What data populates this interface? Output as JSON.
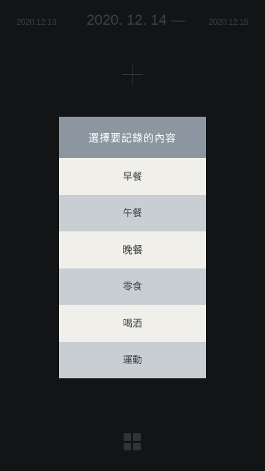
{
  "date_nav": {
    "prev": "2020.12.13",
    "current": "2020. 12. 14 —",
    "next": "2020.12.15"
  },
  "modal": {
    "title": "選擇要記錄的內容",
    "options": [
      {
        "label": "早餐"
      },
      {
        "label": "午餐"
      },
      {
        "label": "晚餐"
      },
      {
        "label": "零食"
      },
      {
        "label": "喝酒"
      },
      {
        "label": "運動"
      }
    ]
  },
  "colors": {
    "background": "#121416",
    "header": "#8c96a0",
    "option_light": "#f0efea",
    "option_dark": "#c9ced3"
  },
  "icons": {
    "add": "plus-icon",
    "menu": "grid-icon"
  }
}
